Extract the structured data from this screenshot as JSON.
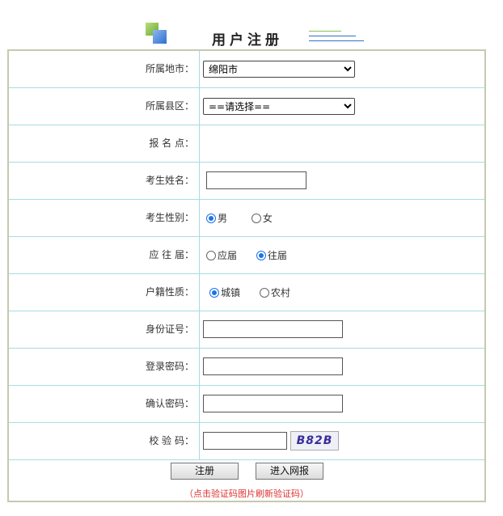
{
  "header": {
    "title": "用户注册"
  },
  "form": {
    "city": {
      "label": "所属地市：",
      "value": "绵阳市"
    },
    "county": {
      "label": "所属县区：",
      "value": "==请选择=="
    },
    "site": {
      "label": "报 名 点："
    },
    "name": {
      "label": "考生姓名：",
      "value": ""
    },
    "gender": {
      "label": "考生性别：",
      "options": [
        "男",
        "女"
      ],
      "selected": "男"
    },
    "grad": {
      "label": "应 往 届：",
      "options": [
        "应届",
        "往届"
      ],
      "selected": "往届"
    },
    "hukou": {
      "label": "户籍性质：",
      "options": [
        "城镇",
        "农村"
      ],
      "selected": "城镇"
    },
    "idcard": {
      "label": "身份证号：",
      "value": ""
    },
    "password": {
      "label": "登录密码：",
      "value": ""
    },
    "confirm": {
      "label": "确认密码：",
      "value": ""
    },
    "captcha": {
      "label": "校 验 码：",
      "value": "",
      "image_text": "B82B"
    }
  },
  "buttons": {
    "register": "注册",
    "enter": "进入网报"
  },
  "hint": "（点击验证码图片刷新验证码）"
}
